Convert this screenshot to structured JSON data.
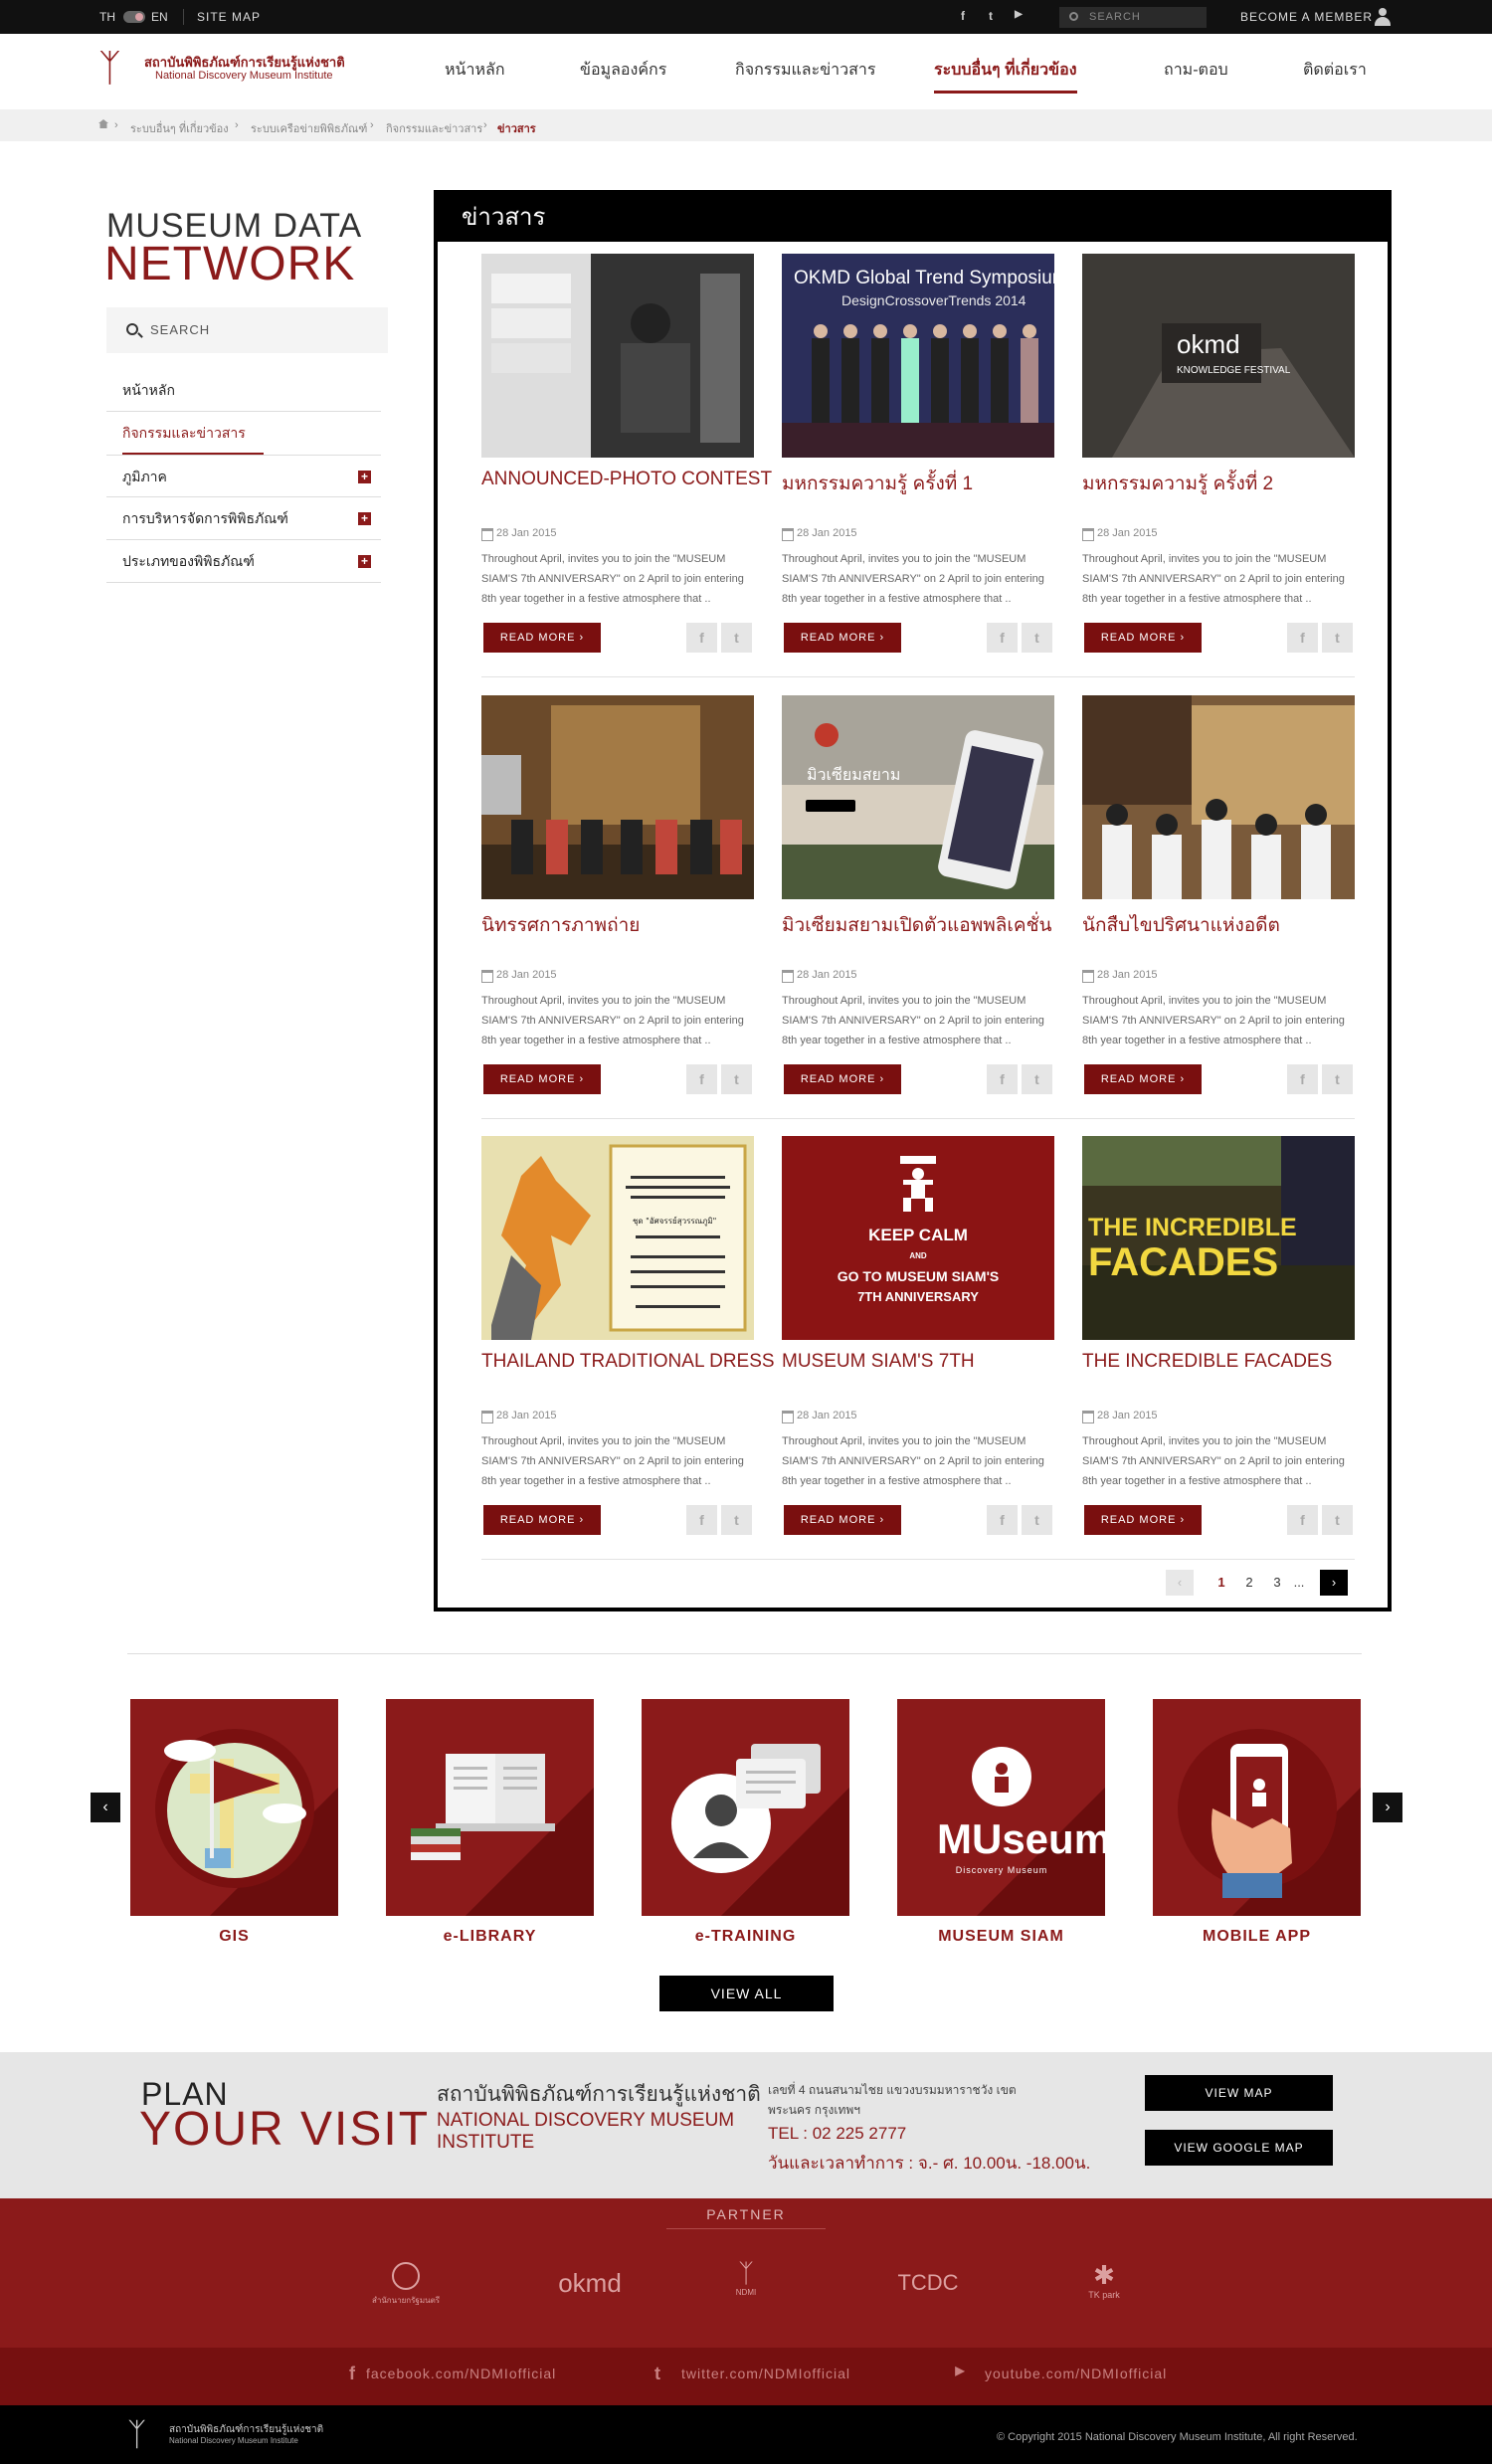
{
  "topbar": {
    "lang_th": "TH",
    "lang_en": "EN",
    "site_map": "SITE MAP",
    "search_placeholder": "SEARCH",
    "become_member": "BECOME A MEMBER",
    "social_icons": [
      "facebook-icon",
      "twitter-icon",
      "youtube-icon"
    ]
  },
  "logo": {
    "name_th": "สถาบันพิพิธภัณฑ์การเรียนรู้แห่งชาติ",
    "name_en": "National Discovery Museum Institute"
  },
  "nav": {
    "items": [
      {
        "label": "หน้าหลัก"
      },
      {
        "label": "ข้อมูลองค์กร"
      },
      {
        "label": "กิจกรรมและข่าวสาร"
      },
      {
        "label": "ระบบอื่นๆ ที่เกี่ยวข้อง",
        "active": true
      },
      {
        "label": "ถาม-ตอบ"
      },
      {
        "label": "ติดต่อเรา"
      }
    ]
  },
  "breadcrumb": [
    "ระบบอื่นๆ ที่เกี่ยวข้อง",
    "ระบบเครือข่ายพิพิธภัณฑ์",
    "กิจกรรมและข่าวสาร",
    "ข่าวสาร"
  ],
  "sidebar": {
    "title_line1": "MUSEUM DATA",
    "title_line2": "NETWORK",
    "search_placeholder": "SEARCH",
    "menu": [
      {
        "label": "หน้าหลัก"
      },
      {
        "label": "กิจกรรมและข่าวสาร",
        "active": true
      },
      {
        "label": "ภูมิภาค",
        "expand": "+"
      },
      {
        "label": "การบริหารจัดการพิพิธภัณฑ์",
        "expand": "+"
      },
      {
        "label": "ประเภทของพิพิธภัณฑ์",
        "expand": "+"
      }
    ]
  },
  "news": {
    "heading": "ข่าวสาร",
    "read_more": "READ MORE",
    "cards": [
      {
        "title": "ANNOUNCED-PHOTO CONTEST",
        "date": "28 Jan 2015",
        "desc": "Throughout April, invites you to join the \"MUSEUM SIAM'S 7th ANNIVERSARY\" on 2 April to join entering 8th year together in a festive atmosphere that .."
      },
      {
        "title": "มหกรรมความรู้ ครั้งที่ 1",
        "date": "28 Jan 2015",
        "desc": "Throughout April, invites you to join the \"MUSEUM SIAM'S 7th ANNIVERSARY\" on 2 April to join entering 8th year together in a festive atmosphere that ..",
        "img_text": "OKMD Global Trend Symposium",
        "img_text2": "DesignCrossoverTrends 2014"
      },
      {
        "title": "มหกรรมความรู้ ครั้งที่ 2",
        "date": "28 Jan 2015",
        "desc": "Throughout April, invites you to join the \"MUSEUM SIAM'S 7th ANNIVERSARY\" on 2 April to join entering 8th year together in a festive atmosphere that ..",
        "img_text": "okmd",
        "img_text2": "KNOWLEDGE FESTIVAL"
      },
      {
        "title": "นิทรรศการภาพถ่าย",
        "date": "28 Jan 2015",
        "desc": "Throughout April, invites you to join the \"MUSEUM SIAM'S 7th ANNIVERSARY\" on 2 April to join entering 8th year together in a festive atmosphere that .."
      },
      {
        "title": "มิวเซียมสยามเปิดตัวแอพพลิเคชั่น",
        "date": "28 Jan 2015",
        "desc": "Throughout April, invites you to join the \"MUSEUM SIAM'S 7th ANNIVERSARY\" on 2 April to join entering 8th year together in a festive atmosphere that ..",
        "img_text": "มิวเซียมสยาม"
      },
      {
        "title": "นักสืบไขปริศนาแห่งอดีต",
        "date": "28 Jan 2015",
        "desc": "Throughout April, invites you to join the \"MUSEUM SIAM'S 7th ANNIVERSARY\" on 2 April to join entering 8th year together in a festive atmosphere that .."
      },
      {
        "title": "THAILAND TRADITIONAL DRESS",
        "date": "28 Jan 2015",
        "desc": "Throughout April, invites you to join the \"MUSEUM SIAM'S 7th ANNIVERSARY\" on 2 April to join entering 8th year together in a festive atmosphere that ..",
        "img_text": "ชุด \"อัศจรรย์สุวรรณภูมิ\""
      },
      {
        "title": "MUSEUM SIAM'S 7TH",
        "date": "28 Jan 2015",
        "desc": "Throughout April, invites you to join the \"MUSEUM SIAM'S 7th ANNIVERSARY\" on 2 April to join entering 8th year together in a festive atmosphere that ..",
        "img_text": "KEEP CALM",
        "img_text2": "AND",
        "img_text3": "GO TO MUSEUM SIAM'S",
        "img_text4": "7TH ANNIVERSARY"
      },
      {
        "title": "THE INCREDIBLE FACADES",
        "date": "28 Jan 2015",
        "desc": "Throughout April, invites you to join the \"MUSEUM SIAM'S 7th ANNIVERSARY\" on 2 April to join entering 8th year together in a festive atmosphere that ..",
        "img_text": "THE INCREDIBLE",
        "img_text2": "FACADES"
      }
    ],
    "pagination": {
      "prev": "‹",
      "pages": [
        "1",
        "2",
        "3",
        "..."
      ],
      "next": "›",
      "current": "1"
    }
  },
  "services": {
    "items": [
      {
        "label": "GIS"
      },
      {
        "label": "e-LIBRARY"
      },
      {
        "label": "e-TRAINING"
      },
      {
        "label": "MUSEUM SIAM",
        "img_text": "MUseum Siam",
        "img_sub": "Discovery Museum"
      },
      {
        "label": "MOBILE APP"
      }
    ],
    "view_all": "VIEW ALL",
    "prev": "‹",
    "next": "›"
  },
  "plan": {
    "title1": "PLAN",
    "title2": "YOUR VISIT",
    "org_th": "สถาบันพิพิธภัณฑ์การเรียนรู้แห่งชาติ",
    "org_en": "NATIONAL DISCOVERY MUSEUM INSTITUTE",
    "address": "เลขที่ 4 ถนนสนามไชย แขวงบรมมหาราชวัง เขตพระนคร กรุงเทพฯ",
    "tel": "TEL : 02 225 2777",
    "hours": "วันและเวลาทำการ : จ.- ศ. 10.00น. -18.00น.",
    "view_map": "VIEW MAP",
    "view_google_map": "VIEW GOOGLE MAP"
  },
  "partner": {
    "title": "PARTNER",
    "logos": [
      "สำนักนายกรัฐมนตรี",
      "okmd",
      "NDMI",
      "TCDC",
      "TK park"
    ]
  },
  "social": {
    "facebook": "facebook.com/NDMIofficial",
    "twitter": "twitter.com/NDMIofficial",
    "youtube": "youtube.com/NDMIofficial"
  },
  "footer": {
    "name_th": "สถาบันพิพิธภัณฑ์การเรียนรู้แห่งชาติ",
    "name_en": "National Discovery Museum Institute",
    "copyright": "© Copyright 2015 National Discovery Museum Institute, All right Reserved."
  }
}
